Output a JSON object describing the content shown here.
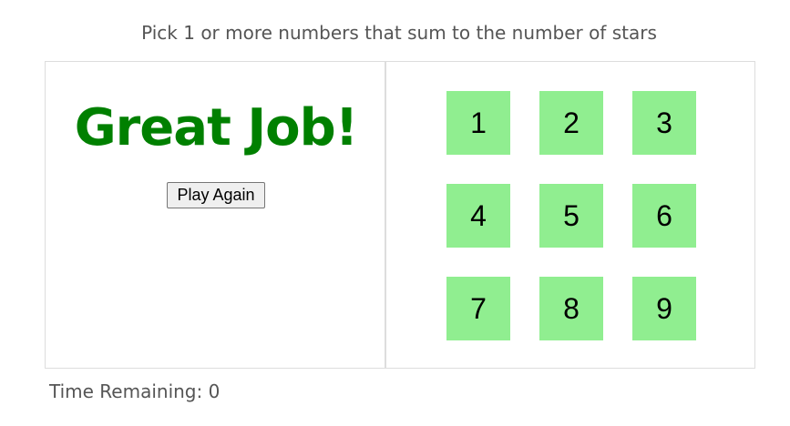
{
  "help_text": "Pick 1 or more numbers that sum to the number of stars",
  "left_panel": {
    "message": "Great Job!",
    "message_color": "#008000",
    "play_again_label": "Play Again"
  },
  "numbers": [
    "1",
    "2",
    "3",
    "4",
    "5",
    "6",
    "7",
    "8",
    "9"
  ],
  "number_color": "#90ee90",
  "timer_text": "Time Remaining: 0"
}
